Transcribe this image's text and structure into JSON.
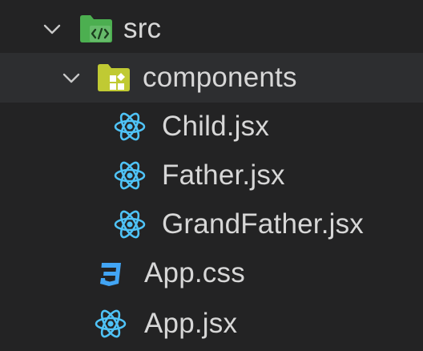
{
  "explorer": {
    "items": [
      {
        "label": "src",
        "kind": "folder",
        "expanded": true,
        "icon": "folder-src-icon"
      },
      {
        "label": "components",
        "kind": "folder",
        "expanded": true,
        "icon": "folder-components-icon"
      },
      {
        "label": "Child.jsx",
        "kind": "file",
        "icon": "react-icon"
      },
      {
        "label": "Father.jsx",
        "kind": "file",
        "icon": "react-icon"
      },
      {
        "label": "GrandFather.jsx",
        "kind": "file",
        "icon": "react-icon"
      },
      {
        "label": "App.css",
        "kind": "file",
        "icon": "css3-icon"
      },
      {
        "label": "App.jsx",
        "kind": "file",
        "icon": "react-icon"
      }
    ]
  },
  "colors": {
    "background": "#232324",
    "selected_row": "#2d2e30",
    "react": "#4fc3f7",
    "css": "#42a5f5",
    "folder_src": "#4caf50",
    "folder_components": "#c0ca33",
    "text": "#d7d7d7"
  }
}
